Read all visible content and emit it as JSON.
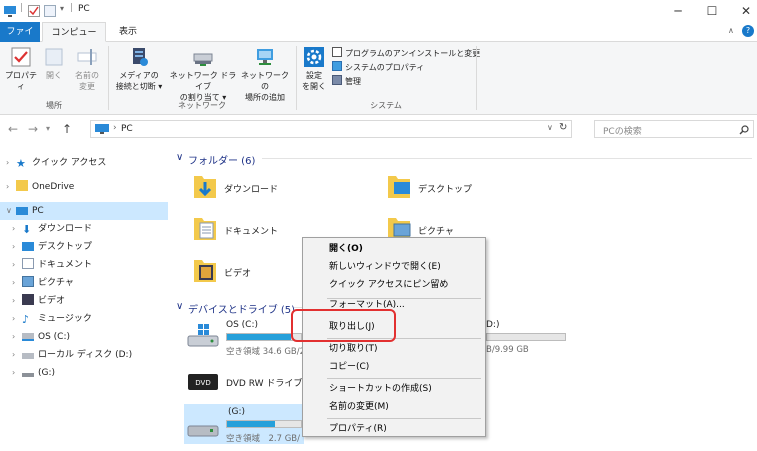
{
  "window": {
    "title": "PC",
    "minimize": "─",
    "maximize": "☐",
    "close": "✕"
  },
  "tabs": {
    "file": "ファイル",
    "computer": "コンピューター",
    "view": "表示"
  },
  "ribbon": {
    "location": {
      "properties": "プロパティ",
      "open": "開く",
      "rename_1": "名前の",
      "rename_2": "変更",
      "label": "場所"
    },
    "network": {
      "media_1": "メディアの",
      "media_2": "接続と切断 ▾",
      "map_1": "ネットワーク ドライブ",
      "map_2": "の割り当て ▾",
      "add_1": "ネットワークの",
      "add_2": "場所の追加",
      "label": "ネットワーク"
    },
    "system": {
      "settings_1": "設定",
      "settings_2": "を開く",
      "uninstall": "プログラムのアンインストールと変更",
      "sysprops": "システムのプロパティ",
      "manage": "管理",
      "label": "システム"
    }
  },
  "address": {
    "path": "PC",
    "search_placeholder": "PCの検索"
  },
  "sidebar": {
    "quick": "クイック アクセス",
    "onedrive": "OneDrive",
    "pc": "PC",
    "downloads": "ダウンロード",
    "desktop": "デスクトップ",
    "documents": "ドキュメント",
    "pictures": "ピクチャ",
    "videos": "ビデオ",
    "music": "ミュージック",
    "os": "OS (C:)",
    "local": "ローカル ディスク (D:)",
    "g": "(G:)"
  },
  "folders": {
    "header": "フォルダー (6)",
    "downloads": "ダウンロード",
    "desktop": "デスクトップ",
    "documents": "ドキュメント",
    "pictures": "ピクチャ",
    "videos": "ビデオ"
  },
  "drives": {
    "header": "デバイスとドライブ (5)",
    "os_name": "OS (C:)",
    "os_free": "空き領域 34.6 GB/2",
    "os_fill": 0.86,
    "d_name_partial": "D:)",
    "d_free_partial": "B/9.99 GB",
    "dvd_name": "DVD RW ドライブ (E:",
    "g_name": "(G:)",
    "g_free": "空き領域　2.7 GB/",
    "g_fill": 0.65
  },
  "context_menu": {
    "open": "開く(O)",
    "open_new": "新しいウィンドウで開く(E)",
    "pin_quick": "クイック アクセスにピン留め",
    "format_partial": "フォーマット(A)...",
    "eject": "取り出し(J)",
    "cut": "切り取り(T)",
    "copy": "コピー(C)",
    "shortcut": "ショートカットの作成(S)",
    "rename": "名前の変更(M)",
    "properties": "プロパティ(R)"
  },
  "colors": {
    "accent": "#1979ca",
    "highlight": "#e23030",
    "bar": "#26a0da",
    "folder": "#f3c94b"
  }
}
